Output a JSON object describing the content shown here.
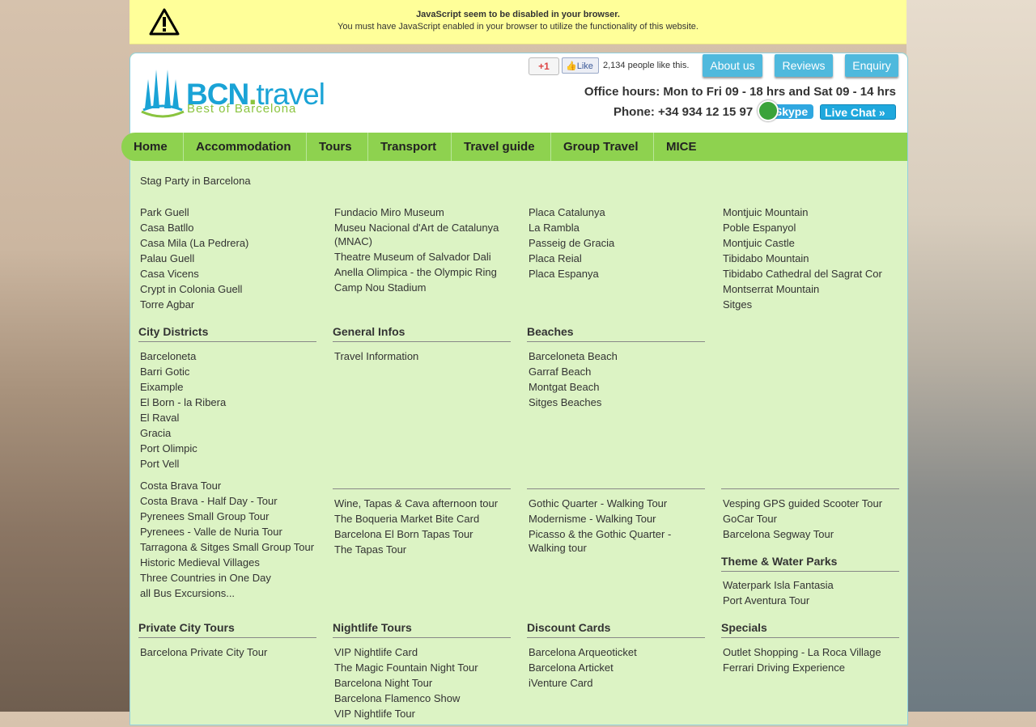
{
  "warning": {
    "line1": "JavaScript seem to be disabled in your browser.",
    "line2": "You must have JavaScript enabled in your browser to utilize the functionality of this website."
  },
  "logo": {
    "name": "BCN",
    "dot": ".",
    "tld": "travel",
    "tagline": "Best of Barcelona"
  },
  "social": {
    "gplus": "+1",
    "fb_like": "Like",
    "fb_count": "2,134 people like this."
  },
  "top_buttons": {
    "about": "About us",
    "reviews": "Reviews",
    "enquiry": "Enquiry"
  },
  "contact": {
    "office_hours": "Office hours: Mon to Fri 09 - 18 hrs and Sat 09 - 14 hrs",
    "phone": "Phone: +34 934 12 15 97",
    "skype": "Skype",
    "live_chat": "Live Chat »"
  },
  "nav": [
    "Home",
    "Accommodation",
    "Tours",
    "Transport",
    "Travel guide",
    "Group Travel",
    "MICE"
  ],
  "intro_link": "Stag Party in Barcelona",
  "section1": {
    "col1": [
      "Park Guell",
      "Casa Batllo",
      "Casa Mila (La Pedrera)",
      "Palau Guell",
      "Casa Vicens",
      "Crypt in Colonia Guell",
      "Torre Agbar"
    ],
    "col2": [
      "Fundacio Miro Museum",
      "Museu Nacional d'Art de Catalunya (MNAC)",
      "Theatre Museum of Salvador Dali",
      "Anella Olimpica - the Olympic Ring",
      "Camp Nou Stadium"
    ],
    "col3": [
      "Placa Catalunya",
      "La Rambla",
      "Passeig de Gracia",
      "Placa Reial",
      "Placa Espanya"
    ],
    "col4": [
      "Montjuic Mountain",
      "Poble Espanyol",
      "Montjuic Castle",
      "Tibidabo Mountain",
      "Tibidabo Cathedral del Sagrat Cor",
      "Montserrat Mountain",
      "Sitges"
    ]
  },
  "section2": {
    "city_districts": {
      "title": "City Districts",
      "items": [
        "Barceloneta",
        "Barri Gotic",
        "Eixample",
        "El Born - la Ribera",
        "El Raval",
        "Gracia",
        "Port Olimpic",
        "Port Vell"
      ]
    },
    "general_infos": {
      "title": "General Infos",
      "items": [
        "Travel Information"
      ]
    },
    "beaches": {
      "title": "Beaches",
      "items": [
        "Barceloneta Beach",
        "Garraf Beach",
        "Montgat Beach",
        "Sitges Beaches"
      ]
    }
  },
  "section3": {
    "col1": [
      "Costa Brava Tour",
      "Costa Brava - Half Day - Tour",
      "Pyrenees Small Group Tour",
      "Pyrenees - Valle de Nuria Tour",
      "Tarragona & Sitges Small Group Tour",
      "Historic Medieval Villages",
      "Three Countries in One Day",
      "all Bus Excursions..."
    ],
    "col2": [
      "Wine, Tapas & Cava afternoon tour",
      "The Boqueria Market Bite Card",
      "Barcelona El Born Tapas Tour",
      "The Tapas Tour"
    ],
    "col3": [
      "Gothic Quarter - Walking Tour",
      "Modernisme - Walking Tour",
      "Picasso & the Gothic Quarter - Walking tour"
    ],
    "col4": [
      "Vesping GPS guided Scooter Tour",
      "GoCar Tour",
      "Barcelona Segway Tour"
    ],
    "theme_parks": {
      "title": "Theme & Water Parks",
      "items": [
        "Waterpark Isla Fantasia",
        "Port Aventura Tour"
      ]
    }
  },
  "section4": {
    "private_city_tours": {
      "title": "Private City Tours",
      "items": [
        "Barcelona Private City Tour"
      ]
    },
    "nightlife_tours": {
      "title": "Nightlife Tours",
      "items": [
        "VIP Nightlife Card",
        "The Magic Fountain Night Tour",
        "Barcelona Night Tour",
        "Barcelona Flamenco Show",
        "VIP Nightlife Tour"
      ]
    },
    "discount_cards": {
      "title": "Discount Cards",
      "items": [
        "Barcelona Arqueoticket",
        "Barcelona Articket",
        "iVenture Card"
      ]
    },
    "specials": {
      "title": "Specials",
      "items": [
        "Outlet Shopping - La Roca Village",
        "Ferrari Driving Experience"
      ]
    }
  }
}
